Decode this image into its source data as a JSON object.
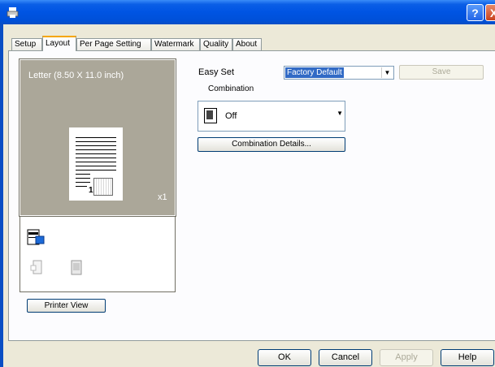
{
  "window": {
    "help_glyph": "?",
    "close_glyph": "X"
  },
  "tabs": [
    {
      "label": "Setup"
    },
    {
      "label": "Layout"
    },
    {
      "label": "Per Page Setting"
    },
    {
      "label": "Watermark"
    },
    {
      "label": "Quality"
    },
    {
      "label": "About"
    }
  ],
  "preview": {
    "paper_label": "Letter  (8.50 X 11.0 inch)",
    "copies_label": "x1",
    "page_number": "1",
    "printer_view_label": "Printer View"
  },
  "easy_set": {
    "label": "Easy Set",
    "value": "Factory Default",
    "save_label": "Save"
  },
  "combination": {
    "label": "Combination",
    "value": "Off",
    "details_label": "Combination Details..."
  },
  "footer": {
    "ok_label": "OK",
    "cancel_label": "Cancel",
    "apply_label": "Apply",
    "help_label": "Help"
  }
}
